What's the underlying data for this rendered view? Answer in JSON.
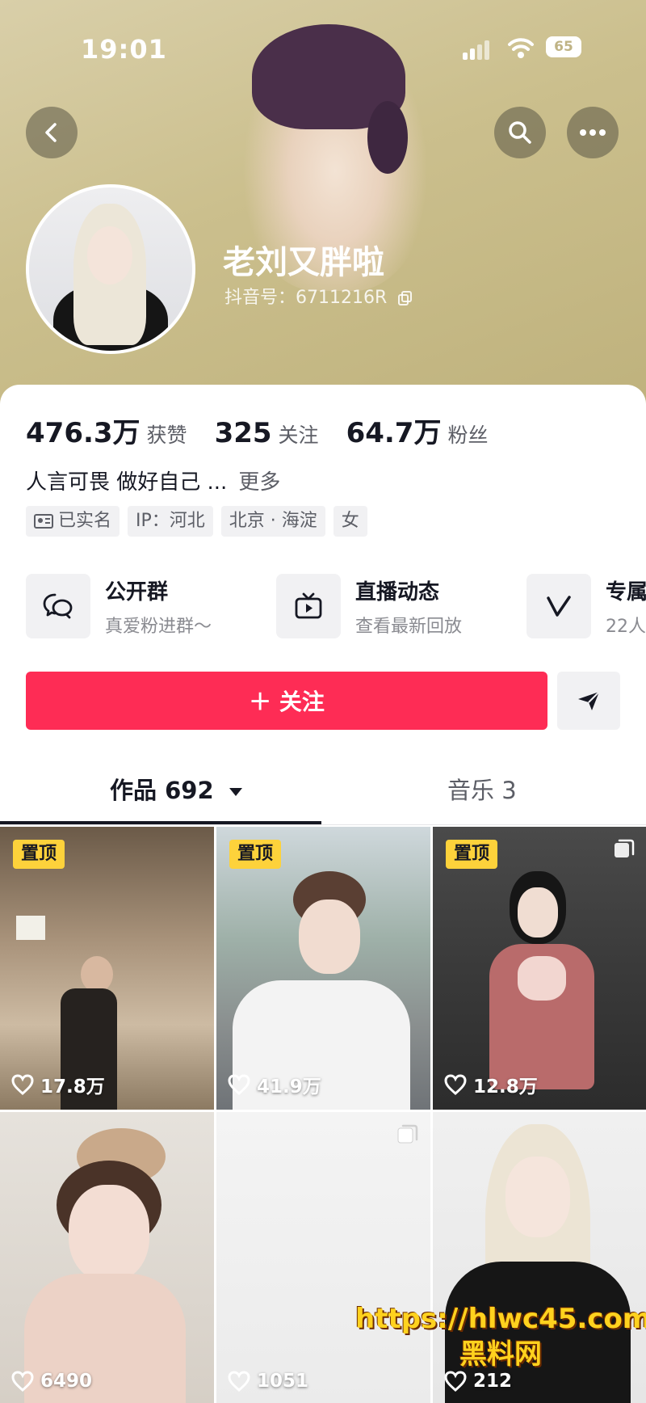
{
  "status_bar": {
    "time": "19:01",
    "battery": "65"
  },
  "profile": {
    "nickname": "老刘又胖啦",
    "douyin_id": "抖音号：6711216R"
  },
  "stats": [
    {
      "value": "476.3万",
      "label": "获赞"
    },
    {
      "value": "325",
      "label": "关注"
    },
    {
      "value": "64.7万",
      "label": "粉丝"
    }
  ],
  "bio": {
    "text": "人言可畏 做好自己 ...",
    "more": "更多"
  },
  "tags": [
    "已实名",
    "IP：河北",
    "北京 · 海淀",
    "女"
  ],
  "features": [
    {
      "title": "公开群",
      "subtitle": "真爱粉进群～",
      "icon": "chat-bubbles-icon"
    },
    {
      "title": "直播动态",
      "subtitle": "查看最新回放",
      "icon": "tv-play-icon"
    },
    {
      "title": "专属",
      "subtitle": "22人",
      "icon": "v-badge-icon"
    }
  ],
  "actions": {
    "follow": "＋ 关注"
  },
  "tabs": {
    "works": "作品 692",
    "music": "音乐 3"
  },
  "videos": [
    {
      "pinned": true,
      "pin_label": "置顶",
      "likes": "17.8万",
      "multi": false
    },
    {
      "pinned": true,
      "pin_label": "置顶",
      "likes": "41.9万",
      "multi": false
    },
    {
      "pinned": true,
      "pin_label": "置顶",
      "likes": "12.8万",
      "multi": true
    },
    {
      "pinned": false,
      "likes": "6490",
      "multi": false
    },
    {
      "pinned": false,
      "likes": "1051",
      "multi": true
    },
    {
      "pinned": false,
      "likes": "212",
      "multi": false
    }
  ],
  "watermark": {
    "line1": "https://hlwc45.com",
    "line2": "黑料网"
  },
  "colors": {
    "accent": "#fe2c55",
    "pin": "#fdd23b",
    "cover": "#cbbf8d"
  }
}
